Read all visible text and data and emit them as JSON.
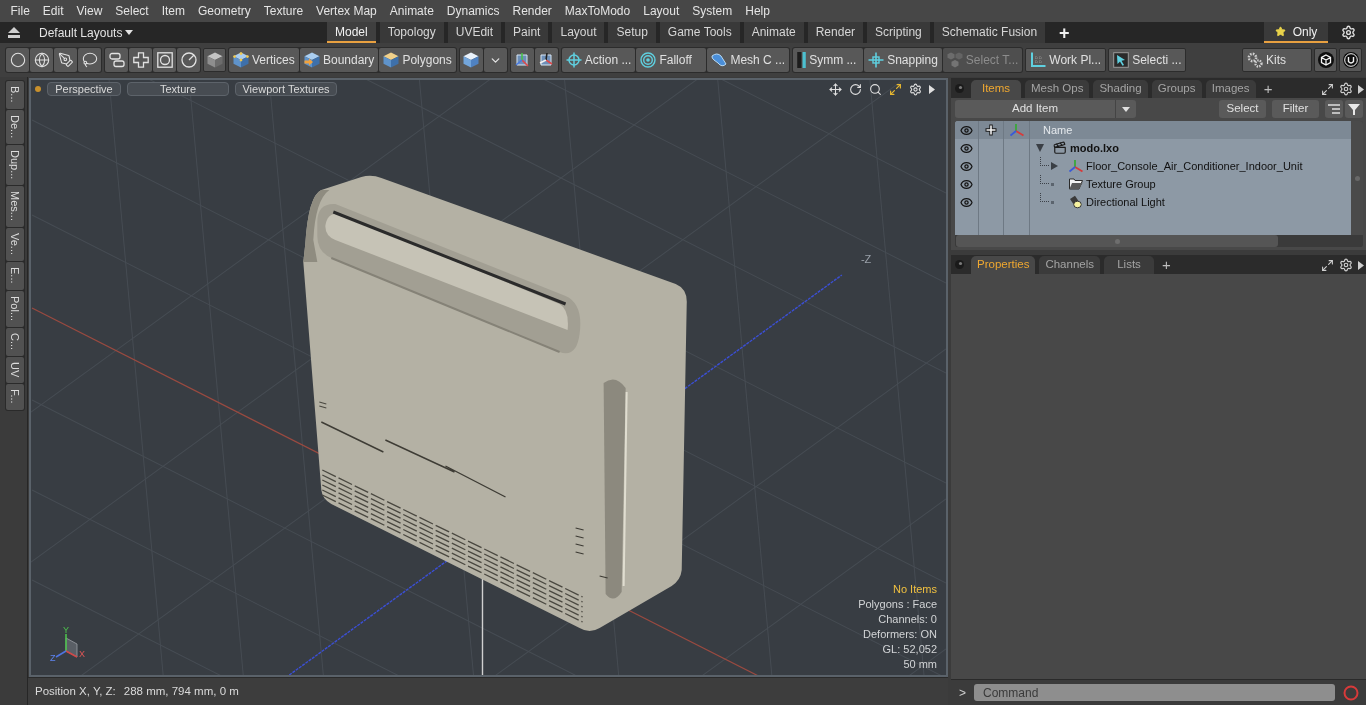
{
  "menu_bar": [
    "File",
    "Edit",
    "View",
    "Select",
    "Item",
    "Geometry",
    "Texture",
    "Vertex Map",
    "Animate",
    "Dynamics",
    "Render",
    "MaxToModo",
    "Layout",
    "System",
    "Help"
  ],
  "layout_bar": {
    "layouts": "Default Layouts",
    "tabs": [
      {
        "label": "Model",
        "selected": true
      },
      {
        "label": "Topology",
        "selected": false
      },
      {
        "label": "UVEdit",
        "selected": false
      },
      {
        "label": "Paint",
        "selected": false
      },
      {
        "label": "Layout",
        "selected": false
      },
      {
        "label": "Setup",
        "selected": false
      },
      {
        "label": "Game Tools",
        "selected": false
      },
      {
        "label": "Animate",
        "selected": false
      },
      {
        "label": "Render",
        "selected": false
      },
      {
        "label": "Scripting",
        "selected": false
      },
      {
        "label": "Schematic Fusion",
        "selected": false
      }
    ],
    "add_tab": "+",
    "only": {
      "label": "Only",
      "selected": true
    }
  },
  "toolbar": {
    "groups": [
      {
        "buttons": [
          {
            "kind": "icon",
            "disabled": false
          },
          {
            "kind": "icon",
            "disabled": false
          },
          {
            "kind": "icon",
            "disabled": false
          },
          {
            "kind": "icon",
            "disabled": false
          }
        ]
      },
      {
        "buttons": [
          {
            "kind": "icon",
            "disabled": false
          },
          {
            "kind": "icon",
            "disabled": false
          },
          {
            "kind": "icon",
            "disabled": false
          },
          {
            "kind": "icon",
            "disabled": false
          }
        ]
      },
      {
        "buttons": [
          {
            "kind": "icon",
            "disabled": false
          }
        ]
      },
      {
        "buttons": [
          {
            "kind": "labeled",
            "label": "Vertices",
            "disabled": false
          },
          {
            "kind": "labeled",
            "label": "Boundary",
            "disabled": false
          },
          {
            "kind": "labeled",
            "label": "Polygons",
            "disabled": false
          }
        ]
      },
      {
        "buttons": [
          {
            "kind": "icon",
            "disabled": false
          },
          {
            "kind": "dropdown",
            "disabled": false
          }
        ]
      },
      {
        "buttons": [
          {
            "kind": "icon",
            "disabled": false
          },
          {
            "kind": "icon",
            "disabled": false
          }
        ]
      },
      {
        "buttons": [
          {
            "kind": "labeled",
            "label": "Action ...",
            "disabled": false
          },
          {
            "kind": "labeled",
            "label": "Falloff",
            "disabled": false
          },
          {
            "kind": "labeled",
            "label": "Mesh C ...",
            "disabled": false
          }
        ]
      },
      {
        "buttons": [
          {
            "kind": "labeled",
            "label": "Symm ...",
            "disabled": false
          },
          {
            "kind": "labeled",
            "label": "Snapping",
            "disabled": false
          },
          {
            "kind": "labeled",
            "label": "Select T...",
            "disabled": true
          }
        ]
      },
      {
        "buttons": [
          {
            "kind": "labeled",
            "label": "Work Pl...",
            "disabled": false
          }
        ]
      },
      {
        "buttons": [
          {
            "kind": "labeled",
            "label": "Selecti ...",
            "disabled": false
          }
        ]
      },
      {
        "buttons": [
          {
            "kind": "labeled",
            "label": "Kits",
            "disabled": false
          }
        ]
      },
      {
        "buttons": [
          {
            "kind": "icon",
            "disabled": false
          }
        ]
      },
      {
        "buttons": [
          {
            "kind": "icon",
            "disabled": false
          }
        ]
      }
    ]
  },
  "side_tabs": [
    "B...",
    "De...",
    "Dup...",
    "Mes...",
    "Ve...",
    "E...",
    "Pol...",
    "C...",
    "UV",
    "F..."
  ],
  "viewport": {
    "header_buttons": [
      "Perspective",
      "Texture",
      "Viewport Textures"
    ],
    "axis_label": "-Z",
    "gizmo_labels": {
      "y": "Y",
      "z": "Z",
      "x": "X"
    },
    "info": [
      {
        "text": "No Items",
        "kind": "highlight"
      },
      {
        "text": "Polygons : Face",
        "kind": "plain"
      },
      {
        "text": "Channels: 0",
        "kind": "plain"
      },
      {
        "text": "Deformers: ON",
        "kind": "plain"
      },
      {
        "text": "GL: 52,052",
        "kind": "plain"
      },
      {
        "text": "50 mm",
        "kind": "plain"
      }
    ]
  },
  "status_bar": {
    "label": "Position X, Y, Z:",
    "value": "288 mm, 794 mm, 0 m"
  },
  "items_panel": {
    "tabs": [
      {
        "label": "Items",
        "selected": true
      },
      {
        "label": "Mesh Ops",
        "selected": false
      },
      {
        "label": "Shading",
        "selected": false
      },
      {
        "label": "Groups",
        "selected": false
      },
      {
        "label": "Images",
        "selected": false
      }
    ],
    "add_tab": "+",
    "add_item": "Add Item",
    "buttons": [
      "Select",
      "Filter"
    ],
    "name_column": "Name",
    "tree": [
      {
        "label": "modo.lxo",
        "kind": "scene",
        "visible": true,
        "expanded": true,
        "children": [
          {
            "label": "Floor_Console_Air_Conditioner_Indoor_Unit",
            "kind": "mesh",
            "visible": true,
            "expanded": false
          },
          {
            "label": "Texture Group",
            "kind": "texture_group",
            "visible": true
          },
          {
            "label": "Directional Light",
            "kind": "light",
            "visible": true
          }
        ]
      }
    ]
  },
  "properties_panel": {
    "tabs": [
      {
        "label": "Properties",
        "selected": true
      },
      {
        "label": "Channels",
        "selected": false
      },
      {
        "label": "Lists",
        "selected": false
      }
    ],
    "add_tab": "+"
  },
  "command_bar": {
    "prompt": ">",
    "placeholder": "Command"
  }
}
